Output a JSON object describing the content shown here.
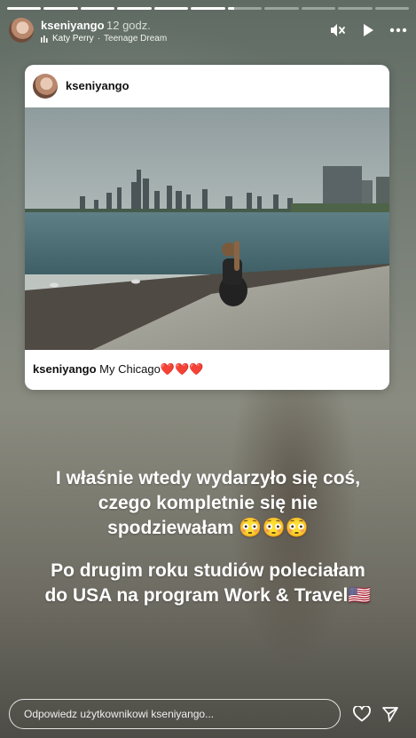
{
  "story": {
    "segments": [
      1,
      1,
      1,
      1,
      1,
      1,
      0.2,
      0,
      0,
      0,
      0
    ],
    "user": "kseniyango",
    "time": "12 godz.",
    "music": {
      "artist": "Katy Perry",
      "separator": "·",
      "title": "Teenage Dream"
    },
    "icons": [
      "mute-icon",
      "play-icon",
      "more-icon"
    ]
  },
  "post": {
    "username": "kseniyango",
    "caption_user": "kseniyango",
    "caption_text": "My Chicago❤️❤️❤️"
  },
  "text": {
    "line1": "I właśnie wtedy wydarzyło się coś,",
    "line2": "czego kompletnie się nie",
    "line3": "spodziewałam 😳😳😳",
    "line4": "Po drugim roku studiów poleciałam",
    "line5": "do USA na program Work & Travel🇺🇸"
  },
  "footer": {
    "reply_placeholder": "Odpowiedz użytkownikowi kseniyango...",
    "icons": [
      "heart-icon",
      "send-icon"
    ]
  }
}
